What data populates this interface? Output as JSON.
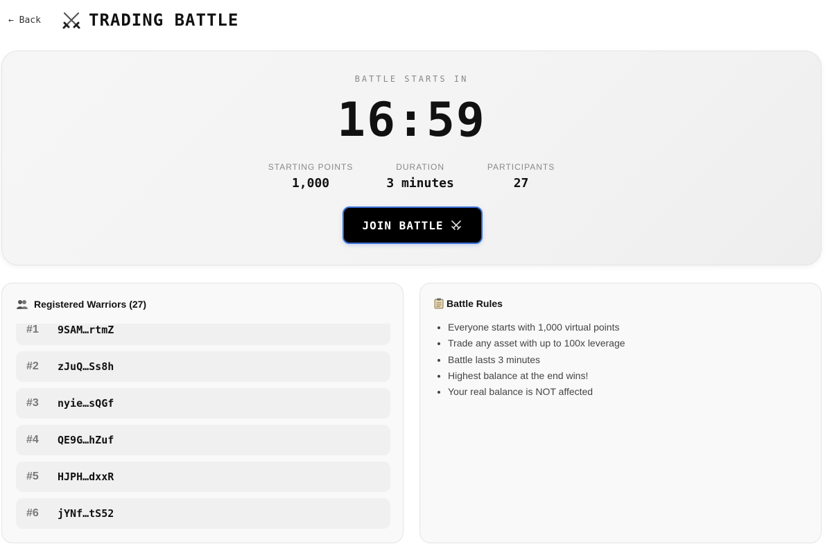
{
  "header": {
    "back_label": "← Back",
    "title": "TRADING BATTLE",
    "title_icon": "crossed-swords-icon"
  },
  "hero": {
    "label": "BATTLE STARTS IN",
    "countdown": "16:59",
    "stats": [
      {
        "label": "STARTING POINTS",
        "value": "1,000"
      },
      {
        "label": "DURATION",
        "value": "3 minutes"
      },
      {
        "label": "PARTICIPANTS",
        "value": "27"
      }
    ],
    "join_label": "JOIN BATTLE",
    "join_icon": "crossed-swords-icon",
    "accent_color": "#3b6fd6"
  },
  "warriors": {
    "title": "Registered Warriors (27)",
    "icon": "people-icon",
    "items": [
      {
        "rank": "#1",
        "address": "9SAM…rtmZ"
      },
      {
        "rank": "#2",
        "address": "zJuQ…Ss8h"
      },
      {
        "rank": "#3",
        "address": "nyie…sQGf"
      },
      {
        "rank": "#4",
        "address": "QE9G…hZuf"
      },
      {
        "rank": "#5",
        "address": "HJPH…dxxR"
      },
      {
        "rank": "#6",
        "address": "jYNf…tS52"
      }
    ]
  },
  "rules": {
    "title": "Battle Rules",
    "icon": "clipboard-icon",
    "items": [
      "Everyone starts with 1,000 virtual points",
      "Trade any asset with up to 100x leverage",
      "Battle lasts 3 minutes",
      "Highest balance at the end wins!",
      "Your real balance is NOT affected"
    ]
  }
}
